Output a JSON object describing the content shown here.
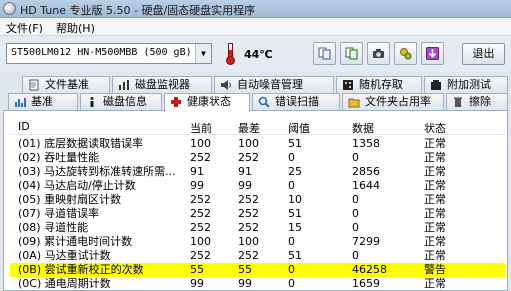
{
  "window": {
    "title": "HD Tune 专业版 5.50 - 硬盘/固态硬盘实用程序"
  },
  "menu": [
    {
      "label": "文件(F)"
    },
    {
      "label": "帮助(H)"
    }
  ],
  "toolbar": {
    "drive": "ST500LM012 HN-M500MBB (500 gB)",
    "temperature": "44℃",
    "exit_label": "退出",
    "buttons": [
      {
        "name": "copy-icon"
      },
      {
        "name": "copy-all-icon"
      },
      {
        "name": "camera-icon"
      },
      {
        "name": "options-icon"
      },
      {
        "name": "download-icon"
      }
    ]
  },
  "tabs_row1": [
    {
      "label": "文件基准",
      "icon": "file-icon"
    },
    {
      "label": "磁盘监视器",
      "icon": "monitor-icon"
    },
    {
      "label": "自动噪音管理",
      "icon": "speaker-icon"
    },
    {
      "label": "随机存取",
      "icon": "random-icon"
    },
    {
      "label": "附加测试",
      "icon": "extra-icon"
    }
  ],
  "tabs_row2": [
    {
      "label": "基准",
      "icon": "benchmark-icon"
    },
    {
      "label": "磁盘信息",
      "icon": "info-icon"
    },
    {
      "label": "健康状态",
      "icon": "health-icon",
      "active": true
    },
    {
      "label": "错误扫描",
      "icon": "scan-icon"
    },
    {
      "label": "文件夹占用率",
      "icon": "folder-icon"
    },
    {
      "label": "擦除",
      "icon": "erase-icon"
    }
  ],
  "table": {
    "headers": {
      "id": "ID",
      "current": "当前",
      "worst": "最差",
      "threshold": "阈值",
      "data": "数据",
      "status": "状态"
    },
    "rows": [
      {
        "id": "(01) 底层数据读取错误率",
        "current": "100",
        "worst": "100",
        "threshold": "51",
        "data": "1358",
        "status": "正常"
      },
      {
        "id": "(02) 吞吐量性能",
        "current": "252",
        "worst": "252",
        "threshold": "0",
        "data": "0",
        "status": "正常"
      },
      {
        "id": "(03) 马达旋转到标准转速所需...",
        "current": "91",
        "worst": "91",
        "threshold": "25",
        "data": "2856",
        "status": "正常"
      },
      {
        "id": "(04) 马达启动/停止计数",
        "current": "99",
        "worst": "99",
        "threshold": "0",
        "data": "1644",
        "status": "正常"
      },
      {
        "id": "(05) 重映射扇区计数",
        "current": "252",
        "worst": "252",
        "threshold": "10",
        "data": "0",
        "status": "正常"
      },
      {
        "id": "(07) 寻道错误率",
        "current": "252",
        "worst": "252",
        "threshold": "51",
        "data": "0",
        "status": "正常"
      },
      {
        "id": "(08) 寻道性能",
        "current": "252",
        "worst": "252",
        "threshold": "15",
        "data": "0",
        "status": "正常"
      },
      {
        "id": "(09) 累计通电时间计数",
        "current": "100",
        "worst": "100",
        "threshold": "0",
        "data": "7299",
        "status": "正常"
      },
      {
        "id": "(0A) 马达重试计数",
        "current": "252",
        "worst": "252",
        "threshold": "51",
        "data": "0",
        "status": "正常"
      },
      {
        "id": "(0B) 尝试重新校正的次数",
        "current": "55",
        "worst": "55",
        "threshold": "0",
        "data": "46258",
        "status": "警告",
        "warn": true
      },
      {
        "id": "(0C) 通电周期计数",
        "current": "99",
        "worst": "99",
        "threshold": "0",
        "data": "1659",
        "status": "正常"
      }
    ]
  }
}
